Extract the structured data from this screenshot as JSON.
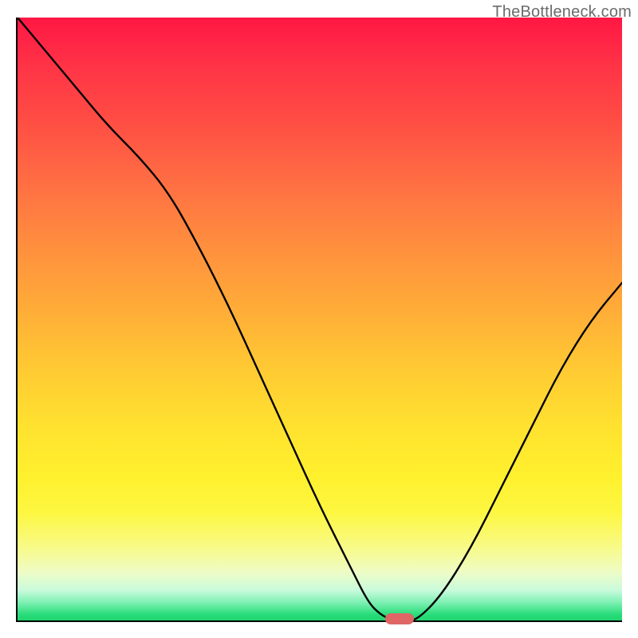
{
  "watermark": "TheBottleneck.com",
  "chart_data": {
    "type": "line",
    "title": "",
    "xlabel": "",
    "ylabel": "",
    "xlim": [
      0,
      100
    ],
    "ylim": [
      0,
      100
    ],
    "x": [
      0,
      5,
      10,
      15,
      20,
      25,
      30,
      35,
      40,
      45,
      50,
      55,
      58,
      60,
      62,
      64,
      66,
      70,
      75,
      80,
      85,
      90,
      95,
      100
    ],
    "values": [
      100,
      94,
      88,
      82,
      77,
      71,
      62,
      52,
      41,
      30,
      19,
      9,
      3,
      1,
      0,
      0,
      0,
      4,
      12,
      22,
      32,
      42,
      50,
      56
    ],
    "marker": {
      "x": 63,
      "y": 0.5
    },
    "background_gradient": {
      "top_color": "#ff1744",
      "mid_color": "#ffe22f",
      "bottom_color": "#1fd56f"
    }
  }
}
